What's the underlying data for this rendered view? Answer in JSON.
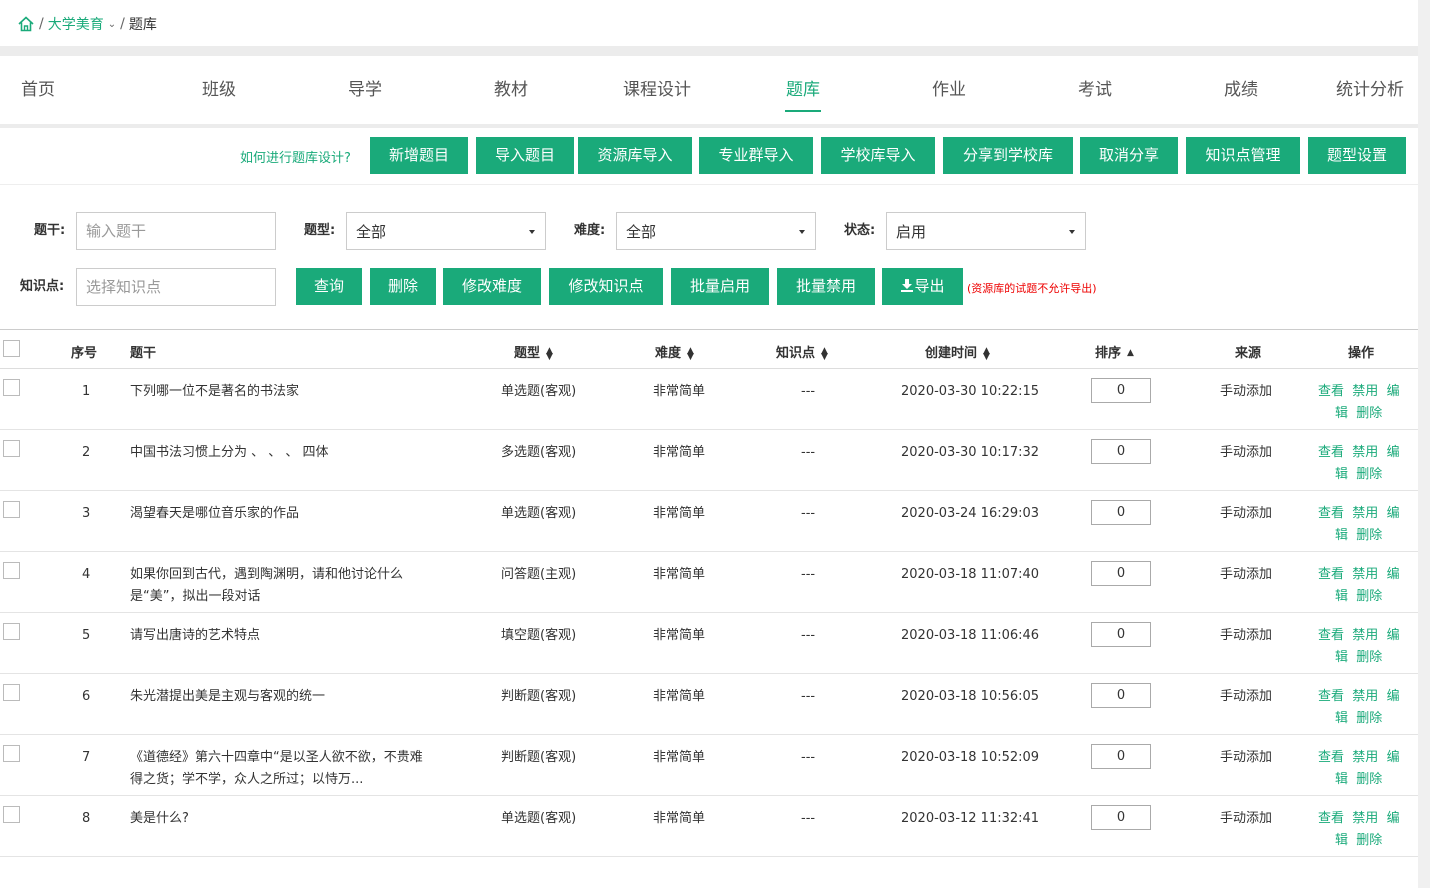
{
  "breadcrumb": {
    "course": "大学美育",
    "current": "题库",
    "sep": "/"
  },
  "nav": {
    "tabs": [
      "首页",
      "班级",
      "导学",
      "教材",
      "课程设计",
      "题库",
      "作业",
      "考试",
      "成绩",
      "统计分析"
    ],
    "active_index": 5
  },
  "toolbar": {
    "help_link": "如何进行题库设计?",
    "buttons": [
      "新增题目",
      "导入题目",
      "资源库导入",
      "专业群导入",
      "学校库导入",
      "分享到学校库",
      "取消分享",
      "知识点管理",
      "题型设置"
    ]
  },
  "filter": {
    "stem_label": "题干:",
    "stem_placeholder": "输入题干",
    "type_label": "题型:",
    "type_value": "全部",
    "difficulty_label": "难度:",
    "difficulty_value": "全部",
    "status_label": "状态:",
    "status_value": "启用",
    "knowledge_label": "知识点:",
    "knowledge_placeholder": "选择知识点",
    "actions": [
      "查询",
      "删除",
      "修改难度",
      "修改知识点",
      "批量启用",
      "批量禁用",
      "导出"
    ],
    "export_note": "(资源库的试题不允许导出)"
  },
  "table": {
    "headers": {
      "index": "序号",
      "stem": "题干",
      "type": "题型",
      "difficulty": "难度",
      "knowledge": "知识点",
      "created": "创建时间",
      "order": "排序",
      "source": "来源",
      "ops": "操作"
    },
    "ops": {
      "view": "查看",
      "disable": "禁用",
      "edit_a": "编",
      "edit_b": "辑",
      "delete": "删除"
    },
    "rows": [
      {
        "index": "1",
        "stem": "下列哪一位不是著名的书法家",
        "stem2": "",
        "type": "单选题(客观)",
        "difficulty": "非常简单",
        "knowledge": "---",
        "created": "2020-03-30 10:22:15",
        "order": "0",
        "source": "手动添加"
      },
      {
        "index": "2",
        "stem": "中国书法习惯上分为 、 、 、 四体",
        "stem2": "",
        "type": "多选题(客观)",
        "difficulty": "非常简单",
        "knowledge": "---",
        "created": "2020-03-30 10:17:32",
        "order": "0",
        "source": "手动添加"
      },
      {
        "index": "3",
        "stem": "渴望春天是哪位音乐家的作品",
        "stem2": "",
        "type": "单选题(客观)",
        "difficulty": "非常简单",
        "knowledge": "---",
        "created": "2020-03-24 16:29:03",
        "order": "0",
        "source": "手动添加"
      },
      {
        "index": "4",
        "stem": "如果你回到古代，遇到陶渊明，请和他讨论什么",
        "stem2": "是“美”，拟出一段对话",
        "type": "问答题(主观)",
        "difficulty": "非常简单",
        "knowledge": "---",
        "created": "2020-03-18 11:07:40",
        "order": "0",
        "source": "手动添加"
      },
      {
        "index": "5",
        "stem": "请写出唐诗的艺术特点",
        "stem2": "",
        "type": "填空题(客观)",
        "difficulty": "非常简单",
        "knowledge": "---",
        "created": "2020-03-18 11:06:46",
        "order": "0",
        "source": "手动添加"
      },
      {
        "index": "6",
        "stem": "朱光潜提出美是主观与客观的统一",
        "stem2": "",
        "type": "判断题(客观)",
        "difficulty": "非常简单",
        "knowledge": "---",
        "created": "2020-03-18 10:56:05",
        "order": "0",
        "source": "手动添加"
      },
      {
        "index": "7",
        "stem": "《道德经》第六十四章中“是以圣人欲不欲，不贵难",
        "stem2": "得之货；学不学，众人之所过；以恃万...",
        "type": "判断题(客观)",
        "difficulty": "非常简单",
        "knowledge": "---",
        "created": "2020-03-18 10:52:09",
        "order": "0",
        "source": "手动添加"
      },
      {
        "index": "8",
        "stem": "美是什么?",
        "stem2": "",
        "type": "单选题(客观)",
        "difficulty": "非常简单",
        "knowledge": "---",
        "created": "2020-03-12 11:32:41",
        "order": "0",
        "source": "手动添加"
      }
    ]
  },
  "colors": {
    "accent": "#1aaa7a",
    "warning": "#ee0000"
  }
}
